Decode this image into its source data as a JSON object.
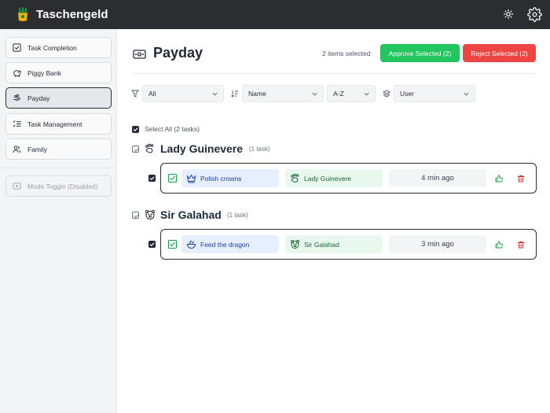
{
  "app": {
    "title": "Taschengeld"
  },
  "sidebar": {
    "items": [
      {
        "label": "Task Completion"
      },
      {
        "label": "Piggy Bank"
      },
      {
        "label": "Payday"
      },
      {
        "label": "Task Management"
      },
      {
        "label": "Family"
      }
    ],
    "mode_toggle": "Mode Toggle (Disabled)"
  },
  "header": {
    "title": "Payday",
    "selected_text": "2 items selected",
    "approve_label": "Approve Selected (2)",
    "reject_label": "Reject Selected (2)"
  },
  "filters": {
    "filter_value": "All",
    "sort_field": "Name",
    "sort_order": "A-Z",
    "group_by": "User"
  },
  "select_all": "Select All (2 tasks)",
  "groups": [
    {
      "name": "Lady Guinevere",
      "count": "(1 task)",
      "tasks": [
        {
          "task": "Polish crowns",
          "user": "Lady Guinevere",
          "time": "4 min ago"
        }
      ]
    },
    {
      "name": "Sir Galahad",
      "count": "(1 task)",
      "tasks": [
        {
          "task": "Feed the dragon",
          "user": "Sir Galahad",
          "time": "3 min ago"
        }
      ]
    }
  ],
  "colors": {
    "topbar": "#2b2d31",
    "approve": "#22c55e",
    "reject": "#ef4444",
    "task_chip": "#e6effd",
    "user_chip": "#e9f8ee"
  }
}
